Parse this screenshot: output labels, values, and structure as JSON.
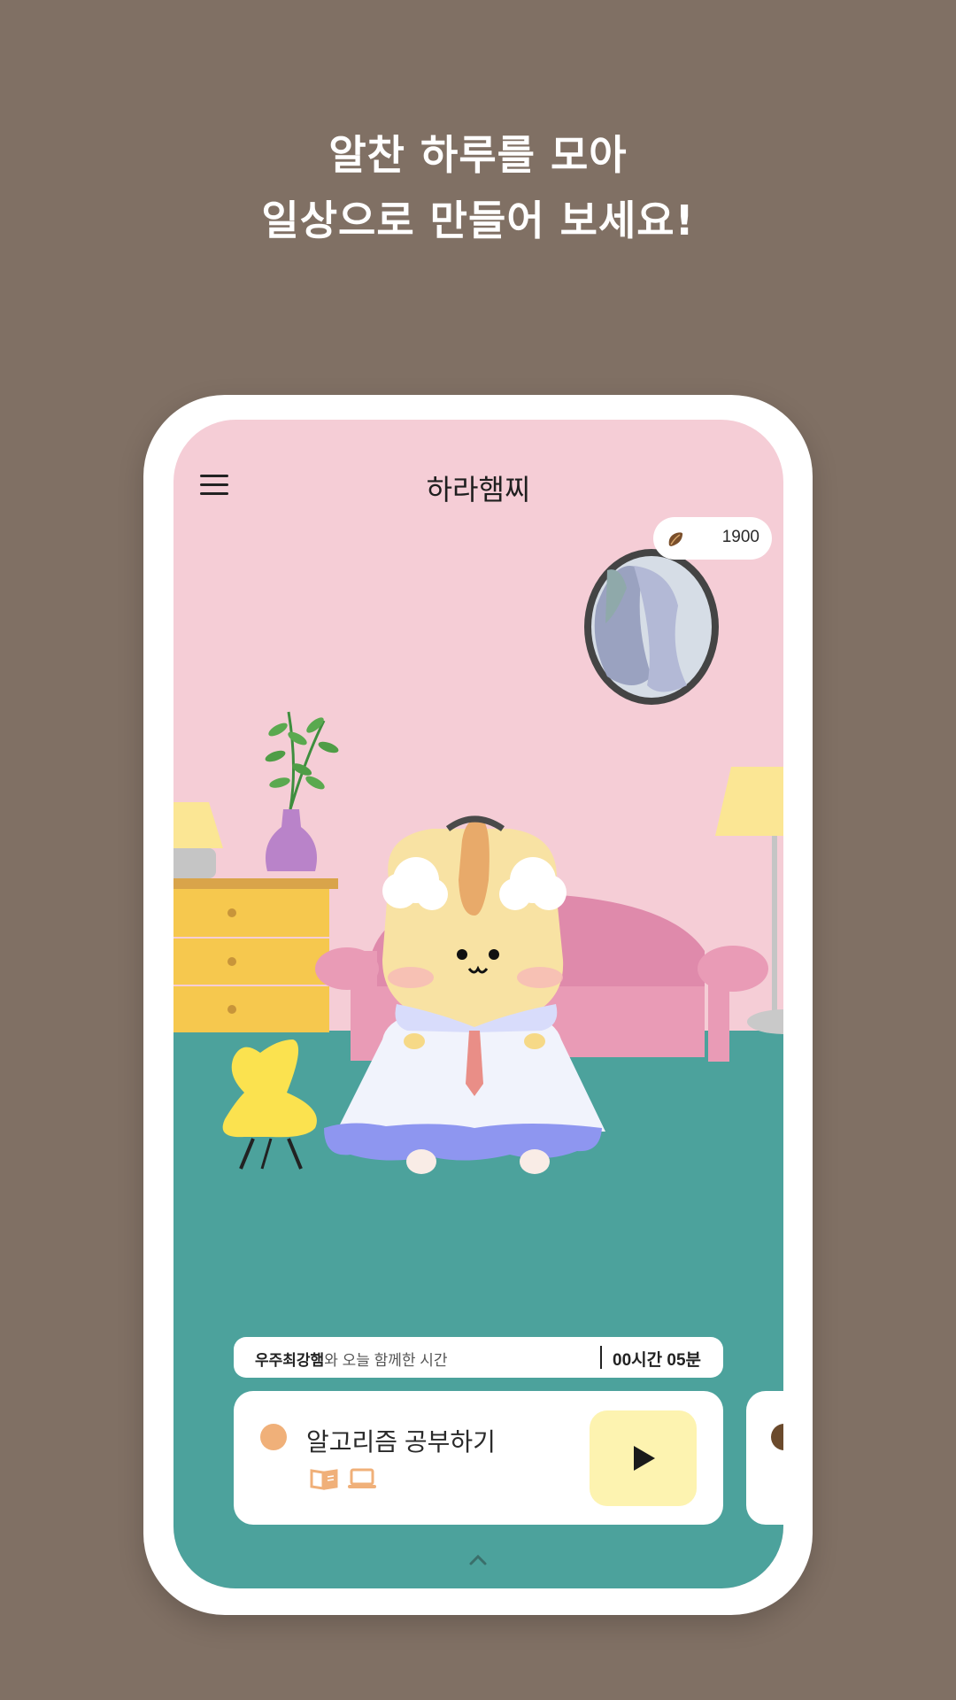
{
  "headline": {
    "line1": "알찬 하루를 모아",
    "line2": "일상으로 만들어 보세요!"
  },
  "app": {
    "logo": "하라햄찌",
    "currency": {
      "icon": "seed-icon",
      "value": "1900"
    }
  },
  "time_bar": {
    "name": "우주최강햄",
    "suffix": "와 오늘 함께한 시간",
    "time": "00시간 05분"
  },
  "task": {
    "title": "알고리즘 공부하기",
    "icons": [
      "book-icon",
      "laptop-icon"
    ],
    "dot_color": "#f0b079"
  },
  "colors": {
    "background": "#807064",
    "wall": "#f5cdd6",
    "floor": "#4ca29c",
    "play_button": "#fdf3b0"
  }
}
